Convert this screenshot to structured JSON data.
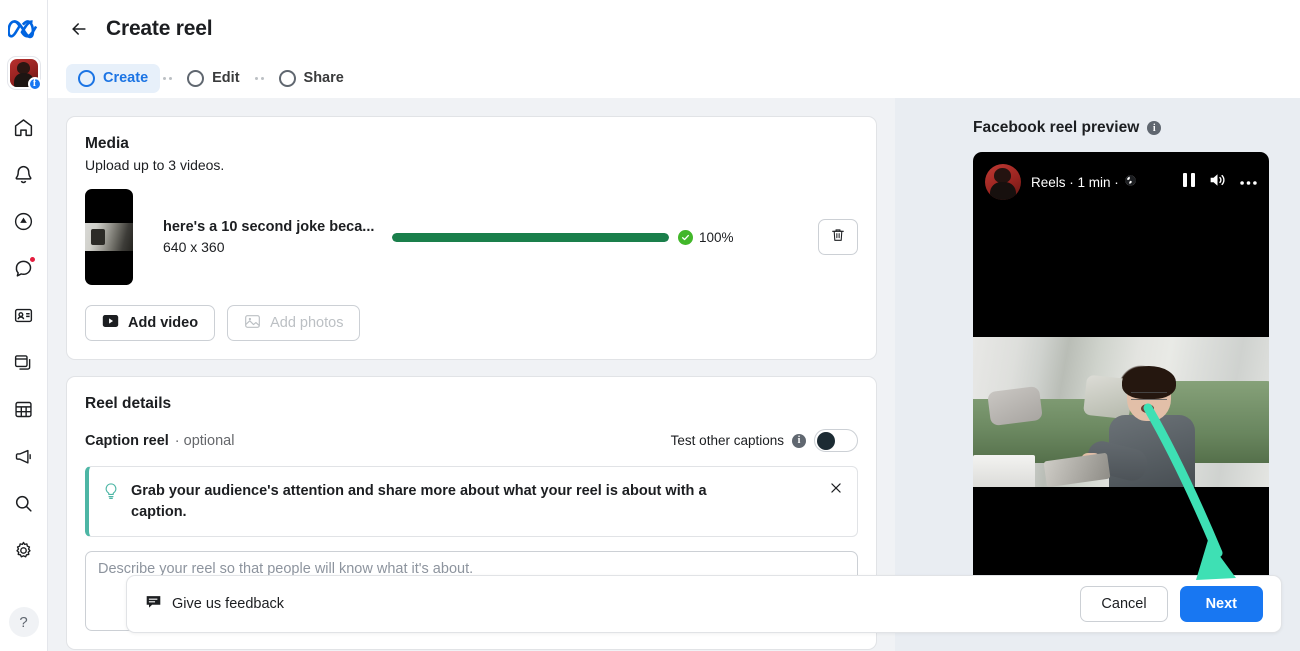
{
  "brand": {
    "logo": "meta-logo",
    "accent": "#1877f2"
  },
  "rail": {
    "account": {
      "name": "account-avatar",
      "badge": "facebook-badge",
      "badge_glyph": "f"
    },
    "items": [
      {
        "name": "home-icon",
        "label": "Home"
      },
      {
        "name": "bell-icon",
        "label": "Notifications"
      },
      {
        "name": "boost-icon",
        "label": "Boost"
      },
      {
        "name": "chat-icon",
        "label": "Messages",
        "badge": true
      },
      {
        "name": "contact-card-icon",
        "label": "Contacts"
      },
      {
        "name": "windows-icon",
        "label": "Pages"
      },
      {
        "name": "grid-icon",
        "label": "Planner"
      },
      {
        "name": "megaphone-icon",
        "label": "Ads"
      },
      {
        "name": "search-icon",
        "label": "Search"
      },
      {
        "name": "gear-icon",
        "label": "Settings"
      }
    ],
    "help_label": "?"
  },
  "header": {
    "back_label": "Back",
    "title": "Create reel"
  },
  "stepper": {
    "steps": [
      {
        "label": "Create",
        "active": true
      },
      {
        "label": "Edit",
        "active": false
      },
      {
        "label": "Share",
        "active": false
      }
    ]
  },
  "media": {
    "title": "Media",
    "subtitle": "Upload up to 3 videos.",
    "file": {
      "name": "here's a 10 second joke beca...",
      "dimensions": "640 x 360",
      "progress_percent": "100%",
      "progress_value": 100,
      "status_icon": "check-circle-icon",
      "delete_icon": "trash-icon"
    },
    "add_video_label": "Add video",
    "add_photos_label": "Add photos"
  },
  "reel_details": {
    "title": "Reel details",
    "caption_label": "Caption reel",
    "caption_optional": "· optional",
    "test_captions_label": "Test other captions",
    "test_captions_on": false,
    "tip": {
      "icon": "lightbulb-icon",
      "text": "Grab your audience's attention and share more about what your reel is about with a caption.",
      "close_icon": "close-icon",
      "accent": "#4db6a5"
    },
    "caption_placeholder": "Describe your reel so that people will know what it's about."
  },
  "preview": {
    "title": "Facebook reel preview",
    "info_icon": "info-icon",
    "card": {
      "account_avatar": "preview-avatar",
      "meta_line": "Reels · 1 min ·",
      "privacy_icon": "globe-icon",
      "controls": [
        "pause-icon",
        "volume-icon",
        "more-options-icon"
      ]
    }
  },
  "footer": {
    "feedback_label": "Give us feedback",
    "feedback_icon": "feedback-icon",
    "cancel_label": "Cancel",
    "next_label": "Next"
  },
  "annotation": {
    "arrow_color": "#3ee0b4",
    "points_to": "next-button"
  }
}
